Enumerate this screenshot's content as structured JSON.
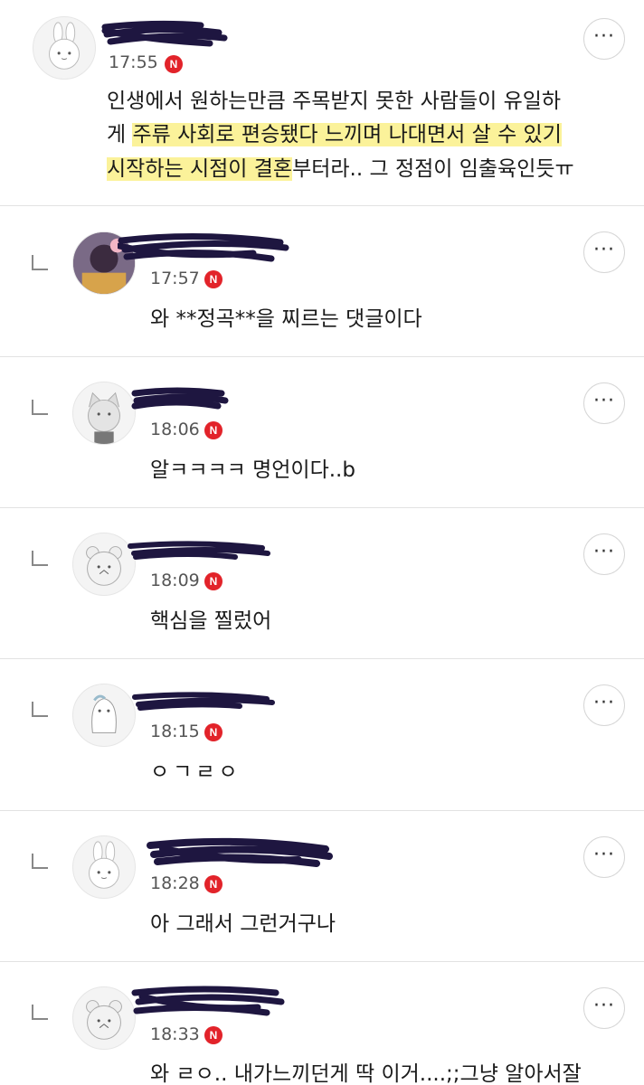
{
  "comments": [
    {
      "time": "17:55",
      "badge": "N",
      "lines": [
        {
          "plain_before": "인생에서 원하는만큼 주목받지 못한 사람들이 유일하",
          "highlight": "",
          "plain_after": ""
        },
        {
          "plain_before": "게 ",
          "highlight": "주류 사회로 편승됐다 느끼며 나대면서 살 수 있기",
          "plain_after": ""
        },
        {
          "plain_before": "",
          "highlight": "시작하는 시점이 결혼",
          "plain_after": "부터라.. 그 정점이 임출육인듯ㅠ"
        }
      ],
      "avatar_icon": "bunny-avatar-icon",
      "reply": false
    },
    {
      "time": "17:57",
      "badge": "N",
      "text": "와 **정곡**을 찌르는 댓글이다",
      "avatar_icon": "photo-avatar-icon",
      "reply": true
    },
    {
      "time": "18:06",
      "badge": "N",
      "text": "알ㅋㅋㅋㅋ 명언이다..b",
      "avatar_icon": "cat-avatar-icon",
      "reply": true
    },
    {
      "time": "18:09",
      "badge": "N",
      "text": "핵심을 찔렀어",
      "avatar_icon": "bear-avatar-icon",
      "reply": true
    },
    {
      "time": "18:15",
      "badge": "N",
      "text": "ㅇㄱㄹㅇ",
      "avatar_icon": "penguin-avatar-icon",
      "reply": true
    },
    {
      "time": "18:28",
      "badge": "N",
      "text": "아 그래서 그런거구나",
      "avatar_icon": "bunny-avatar-icon",
      "reply": true
    },
    {
      "time": "18:33",
      "badge": "N",
      "text": "와 ㄹㅇ.. 내가느끼던게 딱 이거....;;그냥 알아서잘",
      "avatar_icon": "bear-avatar-icon",
      "reply": true
    }
  ],
  "more_button_label": "···",
  "colors": {
    "highlight": "#fbf29a",
    "badge": "#e2232a",
    "scribble": "#1e1640"
  }
}
